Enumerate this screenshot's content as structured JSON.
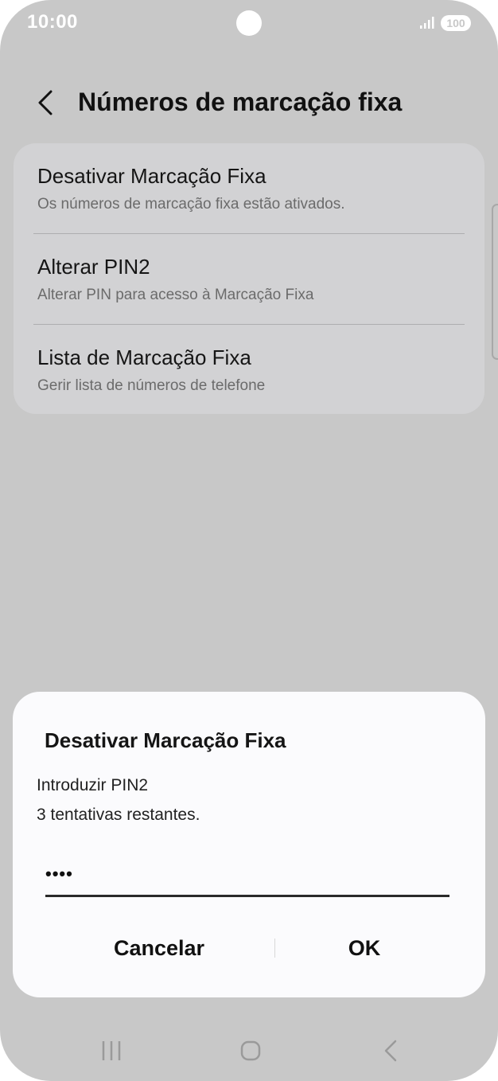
{
  "status_bar": {
    "time": "10:00",
    "battery": "100"
  },
  "header": {
    "title": "Números de marcação fixa",
    "back_icon": "chevron-left-icon"
  },
  "settings": {
    "items": [
      {
        "title": "Desativar Marcação Fixa",
        "subtitle": "Os números de marcação fixa estão ativados."
      },
      {
        "title": "Alterar PIN2",
        "subtitle": "Alterar PIN para acesso à Marcação Fixa"
      },
      {
        "title": "Lista de Marcação Fixa",
        "subtitle": "Gerir lista de números de telefone"
      }
    ]
  },
  "dialog": {
    "title": "Desativar Marcação Fixa",
    "message_line1": "Introduzir PIN2",
    "message_line2": "3 tentativas restantes.",
    "pin_masked": "••••",
    "cancel_label": "Cancelar",
    "ok_label": "OK"
  },
  "nav_bar": {
    "recent_icon": "recent-apps-icon",
    "home_icon": "home-icon",
    "back_icon": "back-icon"
  },
  "colors": {
    "background": "#c8c8c8",
    "card": "#d2d2d4",
    "dialog": "#fbfbfd",
    "text": "#151515"
  }
}
